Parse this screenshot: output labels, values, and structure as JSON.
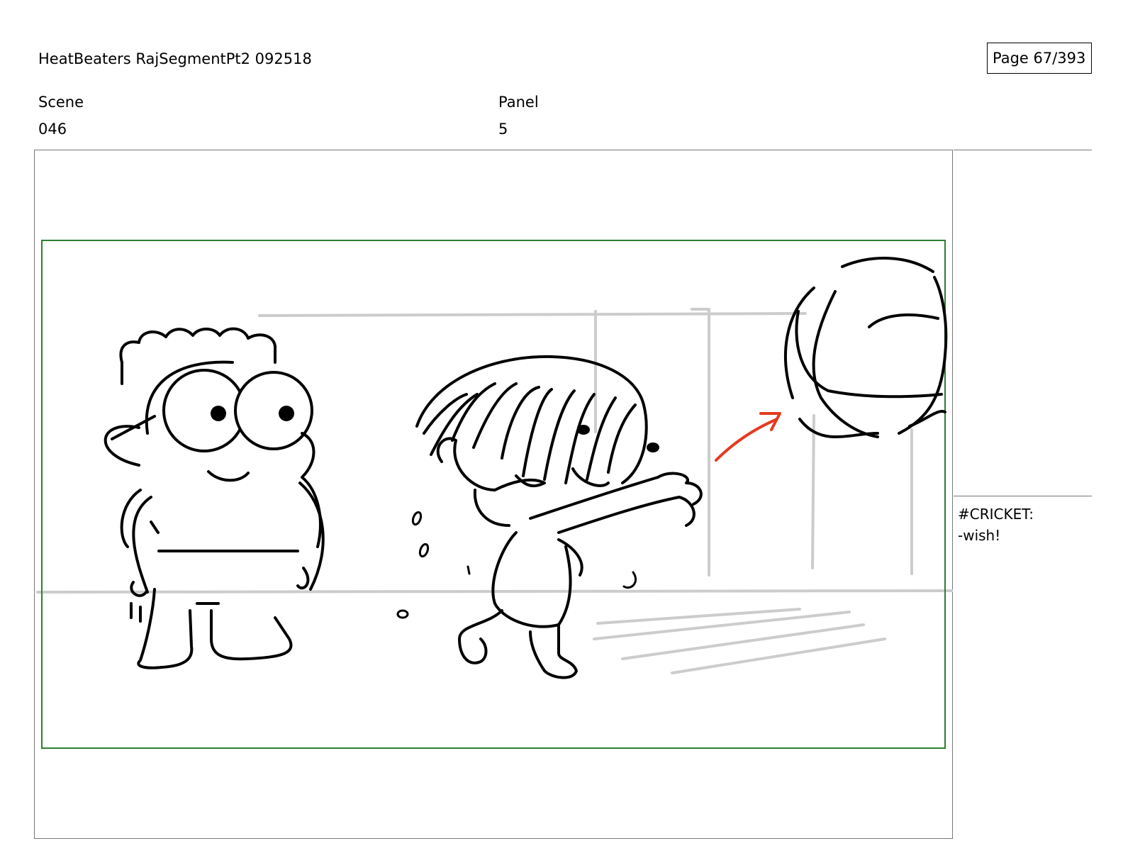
{
  "header": {
    "title": "HeatBeaters RajSegmentPt2 092518",
    "page_label": "Page  67/393"
  },
  "meta": {
    "scene_label": "Scene",
    "scene_value": "046",
    "panel_label": "Panel",
    "panel_value": "5"
  },
  "notes": {
    "speaker": "#CRICKET:",
    "line": "-wish!"
  },
  "colors": {
    "safe_frame": "#2e7d32",
    "motion_arrow": "#e53a1e",
    "background_lines": "#cccccc"
  }
}
